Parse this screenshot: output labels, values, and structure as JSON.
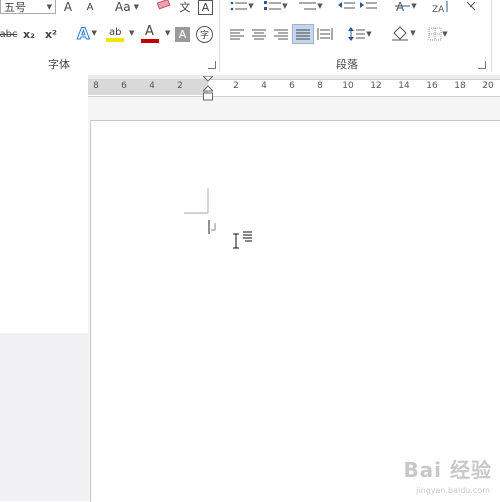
{
  "ribbon": {
    "font_group_label": "字体",
    "paragraph_group_label": "段落",
    "font_size_value": "五号",
    "grow_font_label": "A",
    "shrink_font_label": "A",
    "change_case_label": "Aa",
    "strikethrough_label": "abc",
    "subscript_label": "x₂",
    "superscript_label": "x²",
    "text_effects_label": "A",
    "highlight_label": "ab",
    "font_color_label": "A",
    "char_shading_label": "A",
    "enclose_char_label": "字",
    "phonetic_guide_label": "文",
    "char_border_label": "A",
    "highlight_color": "#f2e600",
    "font_color": "#c00000",
    "accent_color": "#2b579a"
  },
  "ruler": {
    "ticks": [
      "8",
      "6",
      "4",
      "2",
      "2",
      "4",
      "6",
      "8",
      "10",
      "12",
      "14",
      "16",
      "18",
      "20"
    ]
  },
  "watermark": {
    "text": "Bai 经验",
    "sub": "jingyan.baidu.com"
  }
}
